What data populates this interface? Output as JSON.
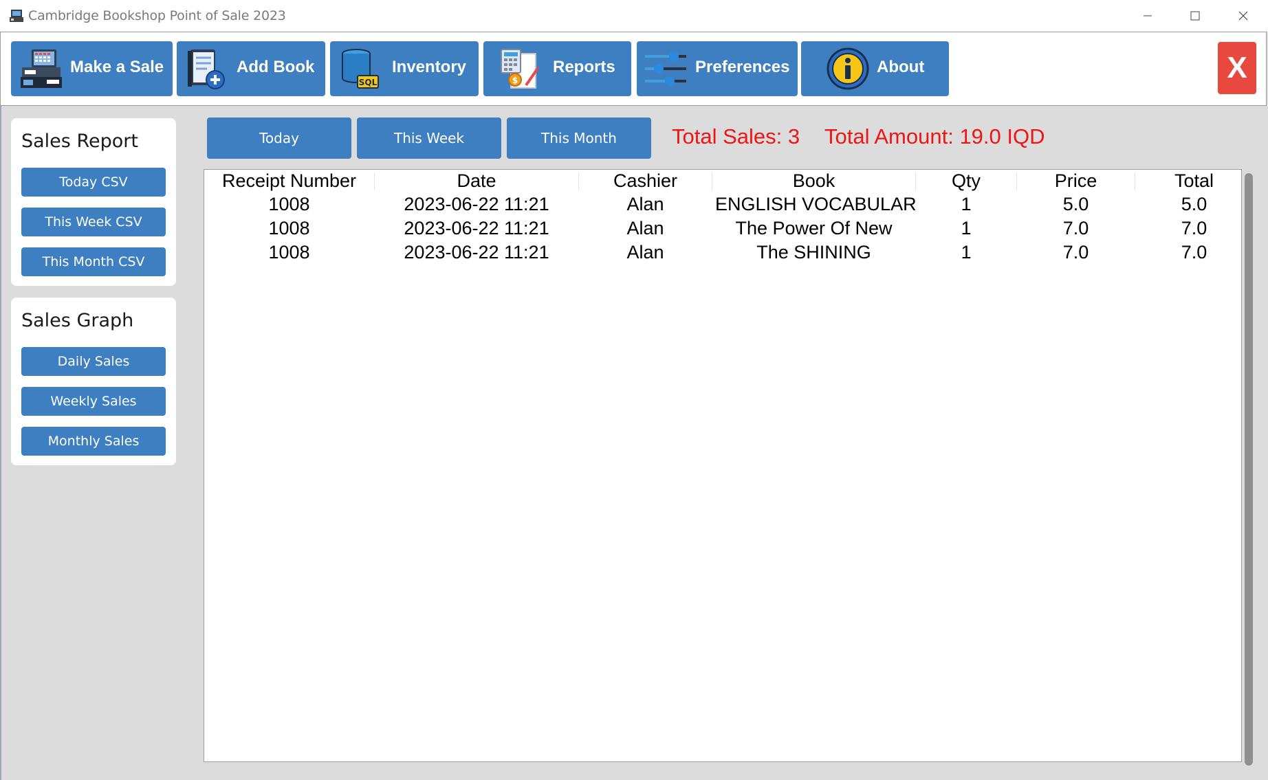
{
  "window": {
    "title": "Cambridge Bookshop Point of Sale 2023",
    "controls": [
      "minimize",
      "maximize",
      "close"
    ]
  },
  "toolbar": {
    "buttons": [
      {
        "label": "Make a Sale",
        "icon": "cash-register-icon"
      },
      {
        "label": "Add Book",
        "icon": "add-book-icon"
      },
      {
        "label": "Inventory",
        "icon": "database-sql-icon"
      },
      {
        "label": "Reports",
        "icon": "reports-calculator-icon"
      },
      {
        "label": "Preferences",
        "icon": "sliders-icon"
      },
      {
        "label": "About",
        "icon": "info-icon"
      }
    ],
    "exit_label": "X"
  },
  "sales_report": {
    "title": "Sales Report",
    "buttons": [
      "Today CSV",
      "This Week CSV",
      "This Month CSV"
    ]
  },
  "sales_graph": {
    "title": "Sales Graph",
    "buttons": [
      "Daily Sales",
      "Weekly Sales",
      "Monthly Sales"
    ]
  },
  "filters": [
    "Today",
    "This Week",
    "This Month"
  ],
  "totals": {
    "sales": "Total Sales: 3",
    "amount": "Total Amount: 19.0 IQD"
  },
  "table": {
    "columns": [
      "Receipt Number",
      "Date",
      "Cashier",
      "Book",
      "Qty",
      "Price",
      "Total"
    ],
    "rows": [
      [
        "1008",
        "2023-06-22 11:21",
        "Alan",
        "ENGLISH VOCABULARY",
        "1",
        "5.0",
        "5.0"
      ],
      [
        "1008",
        "2023-06-22 11:21",
        "Alan",
        "The Power Of New",
        "1",
        "7.0",
        "7.0"
      ],
      [
        "1008",
        "2023-06-22 11:21",
        "Alan",
        "The SHINING",
        "1",
        "7.0",
        "7.0"
      ]
    ]
  },
  "colors": {
    "button_blue": "#3d7fc1",
    "exit_red": "#e8493e",
    "totals_red": "#ee1515",
    "background": "#dcdcdc"
  }
}
